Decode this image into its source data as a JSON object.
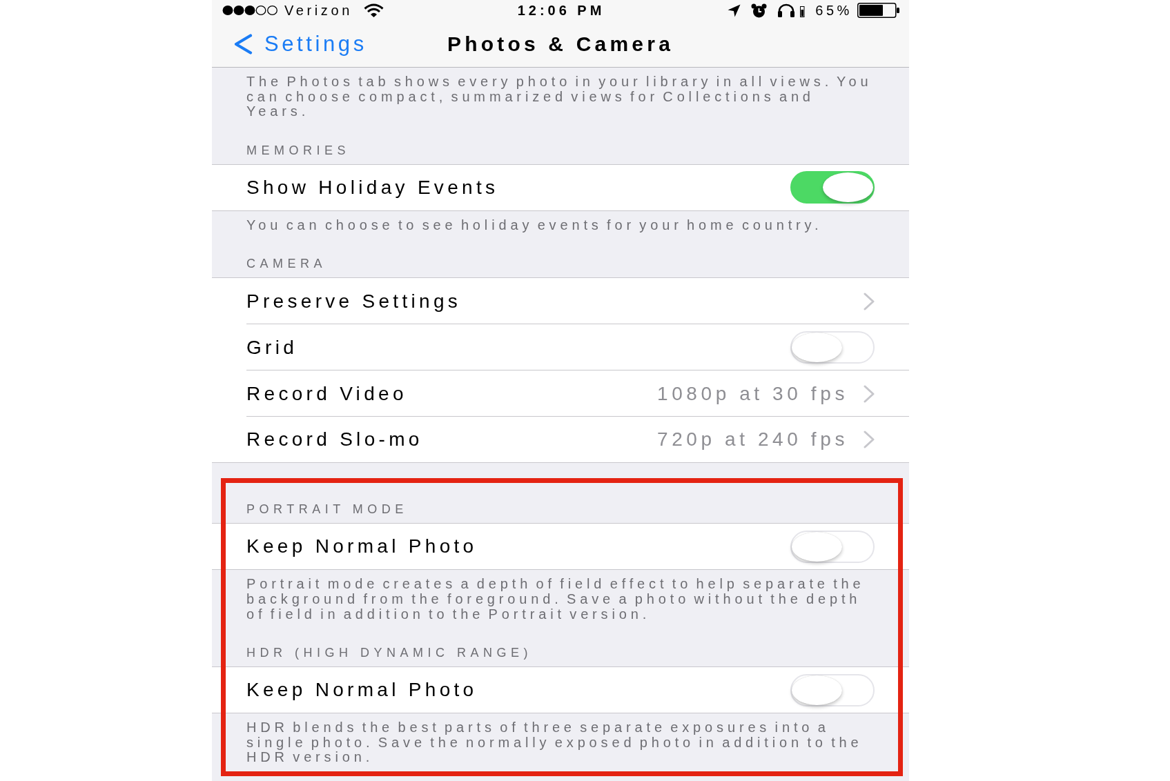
{
  "status_bar": {
    "carrier": "Verizon",
    "time": "12:06 PM",
    "battery_percent": "65%"
  },
  "nav_bar": {
    "back_label": "Settings",
    "title": "Photos & Camera"
  },
  "intro_text": "The Photos tab shows every photo in your library in all views. You can choose compact, summarized views for Collections and Years.",
  "sections": [
    {
      "header": "MEMORIES",
      "highlighted": false,
      "rows": [
        {
          "kind": "toggle",
          "label": "Show Holiday Events",
          "on": true
        }
      ],
      "footer": "You can choose to see holiday events for your home country."
    },
    {
      "header": "CAMERA",
      "highlighted": false,
      "rows": [
        {
          "kind": "link",
          "label": "Preserve Settings"
        },
        {
          "kind": "toggle",
          "label": "Grid",
          "on": false
        },
        {
          "kind": "link",
          "label": "Record Video",
          "value": "1080p at 30 fps"
        },
        {
          "kind": "link",
          "label": "Record Slo-mo",
          "value": "720p at 240 fps"
        }
      ]
    },
    {
      "header": "PORTRAIT MODE",
      "highlighted": true,
      "rows": [
        {
          "kind": "toggle",
          "label": "Keep Normal Photo",
          "on": false
        }
      ],
      "footer": "Portrait mode creates a depth of field effect to help separate the background from the foreground. Save a photo without the depth of field in addition to the Portrait version."
    },
    {
      "header": "HDR (HIGH DYNAMIC RANGE)",
      "highlighted": true,
      "rows": [
        {
          "kind": "toggle",
          "label": "Keep Normal Photo",
          "on": false
        }
      ],
      "footer": "HDR blends the best parts of three separate exposures into a single photo. Save the normally exposed photo in addition to the HDR version."
    }
  ]
}
